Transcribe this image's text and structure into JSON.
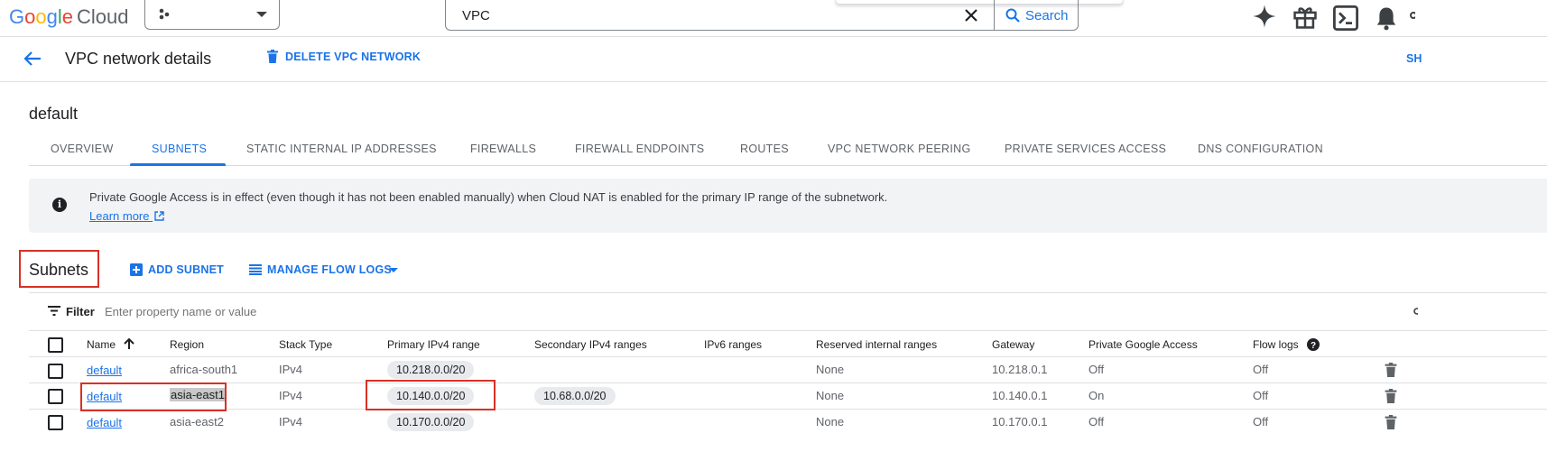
{
  "topbar": {
    "logo_letters": [
      "G",
      "o",
      "o",
      "g",
      "l",
      "e"
    ],
    "logo_product": "Cloud",
    "search_value": "VPC",
    "search_button": "Search"
  },
  "page": {
    "title": "VPC network details",
    "delete_label": "DELETE VPC NETWORK",
    "right_cut_label": "SH"
  },
  "resource": {
    "name": "default"
  },
  "tabs": [
    {
      "label": "OVERVIEW"
    },
    {
      "label": "SUBNETS",
      "active": true
    },
    {
      "label": "STATIC INTERNAL IP ADDRESSES"
    },
    {
      "label": "FIREWALLS"
    },
    {
      "label": "FIREWALL ENDPOINTS"
    },
    {
      "label": "ROUTES"
    },
    {
      "label": "VPC NETWORK PEERING"
    },
    {
      "label": "PRIVATE SERVICES ACCESS"
    },
    {
      "label": "DNS CONFIGURATION"
    }
  ],
  "banner": {
    "text": "Private Google Access is in effect (even though it has not been enabled manually) when Cloud NAT is enabled for the primary IP range of the subnetwork.",
    "link": "Learn more"
  },
  "subnets": {
    "title": "Subnets",
    "add_label": "ADD SUBNET",
    "manage_label": "MANAGE FLOW LOGS",
    "filter_label": "Filter",
    "filter_placeholder": "Enter property name or value"
  },
  "table": {
    "columns": [
      "Name",
      "Region",
      "Stack Type",
      "Primary IPv4 range",
      "Secondary IPv4 ranges",
      "IPv6 ranges",
      "Reserved internal ranges",
      "Gateway",
      "Private Google Access",
      "Flow logs"
    ],
    "rows": [
      {
        "name": "default",
        "region": "africa-south1",
        "stack": "IPv4",
        "primary": "10.218.0.0/20",
        "secondary": "",
        "ipv6": "",
        "reserved": "None",
        "gateway": "10.218.0.1",
        "pga": "Off",
        "flow": "Off"
      },
      {
        "name": "default",
        "region": "asia-east1",
        "stack": "IPv4",
        "primary": "10.140.0.0/20",
        "secondary": "10.68.0.0/20",
        "ipv6": "",
        "reserved": "None",
        "gateway": "10.140.0.1",
        "pga": "On",
        "flow": "Off"
      },
      {
        "name": "default",
        "region": "asia-east2",
        "stack": "IPv4",
        "primary": "10.170.0.0/20",
        "secondary": "",
        "ipv6": "",
        "reserved": "None",
        "gateway": "10.170.0.1",
        "pga": "Off",
        "flow": "Off"
      }
    ]
  },
  "colors": {
    "accent": "#1a73e8",
    "highlight_box": "#d93025",
    "chip_bg": "#e8eaed"
  },
  "icons": [
    "close-icon",
    "search-icon",
    "gemini-sparkle-icon",
    "gift-icon",
    "cloud-shell-icon",
    "bell-icon",
    "back-arrow-icon",
    "trash-icon",
    "info-icon",
    "external-link-icon",
    "add-box-icon",
    "list-icon",
    "dropdown-icon",
    "filter-icon",
    "sort-arrow-icon",
    "help-icon"
  ]
}
